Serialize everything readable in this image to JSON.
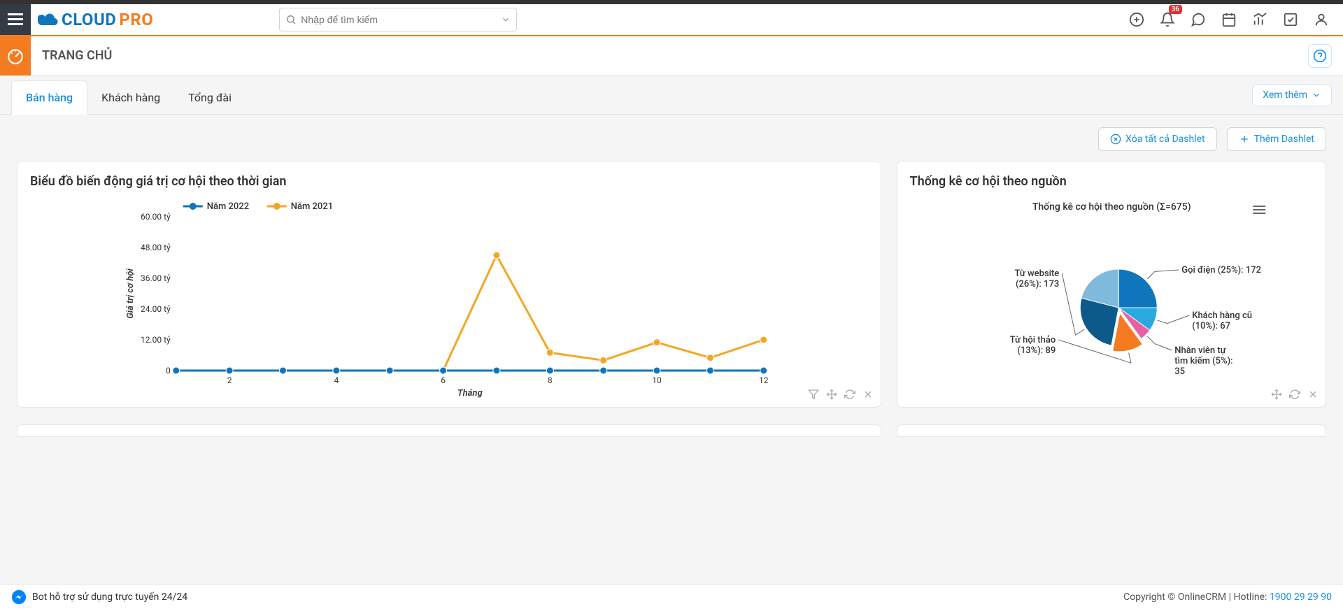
{
  "header": {
    "logo_main": "CLOUD",
    "logo_sub": "PRO",
    "search_placeholder": "Nhập để tìm kiếm",
    "notif_count": "36"
  },
  "page": {
    "title": "TRANG CHỦ"
  },
  "tabs": [
    "Bán hàng",
    "Khách hàng",
    "Tổng đài"
  ],
  "view_more_label": "Xem thêm",
  "actions": {
    "clear_label": "Xóa tất cả Dashlet",
    "add_label": "Thêm Dashlet"
  },
  "footer": {
    "bot_label": "Bot hỗ trợ sử dụng trực tuyến 24/24",
    "copyright": "Copyright © OnlineCRM",
    "hotline_label": "Hotline:",
    "hotline_number": "1900 29 29 90"
  },
  "chart_data": [
    {
      "type": "line",
      "title": "Biểu đồ biến động giá trị cơ hội theo thời gian",
      "xlabel": "Tháng",
      "ylabel": "Giá trị cơ hội",
      "y_unit": "tỷ",
      "ylim": [
        0,
        60
      ],
      "y_ticks": [
        0,
        12,
        24,
        36,
        48,
        60
      ],
      "y_tick_labels": [
        "0",
        "12.00 tỷ",
        "24.00 tỷ",
        "36.00 tỷ",
        "48.00 tỷ",
        "60.00 tỷ"
      ],
      "x": [
        1,
        2,
        3,
        4,
        5,
        6,
        7,
        8,
        9,
        10,
        11,
        12
      ],
      "x_tick_labels": [
        "",
        "2",
        "",
        "4",
        "",
        "6",
        "",
        "8",
        "",
        "10",
        "",
        "12"
      ],
      "series": [
        {
          "name": "Năm 2022",
          "color": "#0f75bc",
          "values": [
            0,
            0,
            0,
            0,
            0,
            0,
            0,
            0,
            0,
            0,
            0,
            0
          ]
        },
        {
          "name": "Năm 2021",
          "color": "#f5a623",
          "values": [
            0,
            0,
            0,
            0,
            0,
            0,
            45,
            7,
            4,
            11,
            5,
            12
          ]
        }
      ]
    },
    {
      "type": "pie",
      "title": "Thống kê cơ hội theo nguồn",
      "sum_label": "Σ=675",
      "subtitle": "Thống kê cơ hội theo nguồn (Σ=675)",
      "slices": [
        {
          "label": "Gọi điện",
          "pct": 25,
          "count": 172,
          "color": "#0f75bc"
        },
        {
          "label": "Khách hàng cũ",
          "pct": 10,
          "count": 67,
          "color": "#2aa8e0"
        },
        {
          "label": "Nhân viên tự tìm kiếm",
          "pct": 5,
          "count": 35,
          "color": "#e85fa2"
        },
        {
          "label": "Từ hội thảo",
          "pct": 13,
          "count": 89,
          "color": "#f47b20"
        },
        {
          "label": "Từ website",
          "pct": 26,
          "count": 173,
          "color": "#0d5a8a"
        }
      ],
      "other_pct": 21
    }
  ]
}
